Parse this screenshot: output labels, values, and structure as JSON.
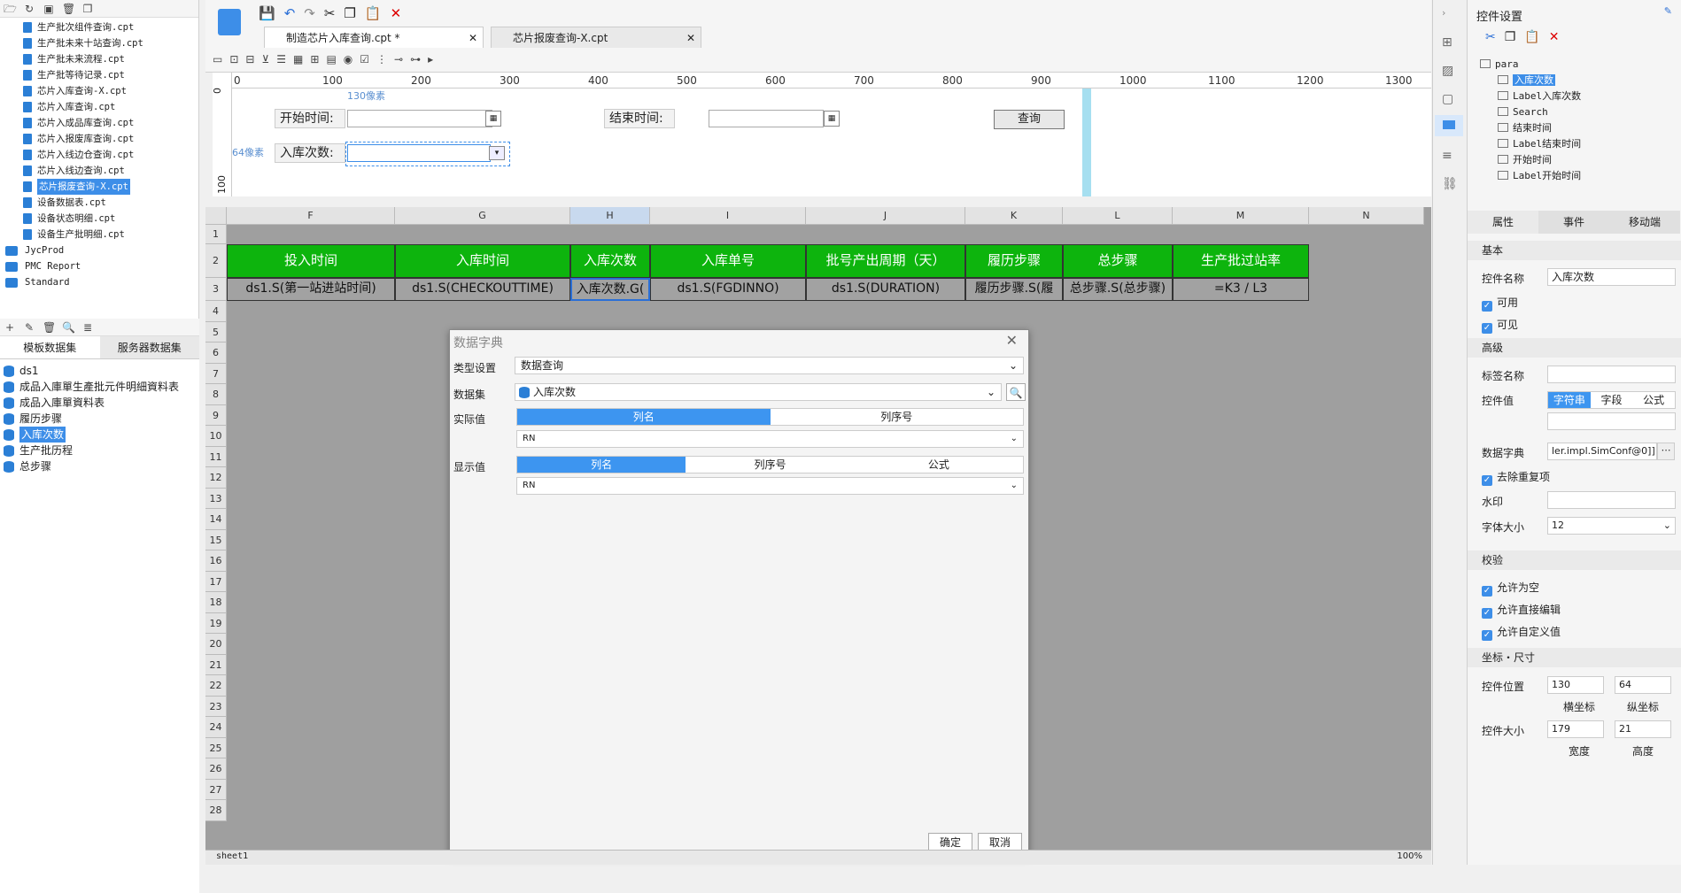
{
  "left": {
    "files": [
      "生产批次组件查询.cpt",
      "生产批未来十站查询.cpt",
      "生产批未来流程.cpt",
      "生产批等待记录.cpt",
      "芯片入库查询-X.cpt",
      "芯片入库查询.cpt",
      "芯片入成品库查询.cpt",
      "芯片入报废库查询.cpt",
      "芯片入线边仓查询.cpt",
      "芯片入线边查询.cpt",
      "芯片报废查询-X.cpt",
      "设备数据表.cpt",
      "设备状态明细.cpt",
      "设备生产批明细.cpt"
    ],
    "selected_file": "芯片报废查询-X.cpt",
    "folders": [
      "JycProd",
      "PMC Report",
      "Standard"
    ],
    "ds_tabs": [
      "模板数据集",
      "服务器数据集"
    ],
    "datasets": [
      "ds1",
      "成品入庫單生產批元件明細資料表",
      "成品入庫單資料表",
      "履历步骤",
      "入库次数",
      "生产批历程",
      "总步骤"
    ],
    "selected_dataset": "入库次数"
  },
  "doc_tabs": [
    "制造芯片入库查询.cpt *",
    "芯片报废查询-X.cpt"
  ],
  "ruler": [
    "0",
    "100",
    "200",
    "300",
    "400",
    "500",
    "600",
    "700",
    "800",
    "900",
    "1000",
    "1100",
    "1200",
    "1300"
  ],
  "vruler": [
    "0",
    "100"
  ],
  "param": {
    "start_label": "开始时间:",
    "end_label": "结束时间:",
    "count_label": "入库次数:",
    "query_btn": "查询",
    "hint_x": "130像素",
    "hint_y": "64像素"
  },
  "sheet": {
    "cols": [
      "F",
      "G",
      "H",
      "I",
      "J",
      "K",
      "L",
      "M",
      "N"
    ],
    "rows": [
      "1",
      "2",
      "3",
      "4",
      "5",
      "6",
      "7",
      "8",
      "9",
      "10",
      "11",
      "12",
      "13",
      "14",
      "15",
      "16",
      "17",
      "18",
      "19",
      "20",
      "21",
      "22",
      "23",
      "24",
      "25",
      "26",
      "27",
      "28"
    ],
    "headers": [
      "投入时间",
      "入库时间",
      "入库次数",
      "入库单号",
      "批号产出周期（天）",
      "履历步骤",
      "总步骤",
      "生产批过站率"
    ],
    "formulas": [
      "ds1.S(第一站进站时间)",
      "ds1.S(CHECKOUTTIME)",
      "入库次数.G(",
      "ds1.S(FGDINNO)",
      "ds1.S(DURATION)",
      "履历步骤.S(履",
      "总步骤.S(总步骤)",
      "=K3 / L3"
    ],
    "sheet_tab": "sheet1",
    "zoom": "100%"
  },
  "dialog": {
    "title": "数据字典",
    "type_label": "类型设置",
    "type_value": "数据查询",
    "dataset_label": "数据集",
    "dataset_value": "入库次数",
    "actual_label": "实际值",
    "actual_tabs": [
      "列名",
      "列序号"
    ],
    "actual_value": "RN",
    "display_label": "显示值",
    "display_tabs": [
      "列名",
      "列序号",
      "公式"
    ],
    "display_value": "RN",
    "ok": "确定",
    "cancel": "取消"
  },
  "right": {
    "title": "控件设置",
    "tree": [
      "para",
      "入库次数",
      "Label入库次数",
      "Search",
      "结束时间",
      "Label结束时间",
      "开始时间",
      "Label开始时间"
    ],
    "tabs": [
      "属性",
      "事件",
      "移动端"
    ],
    "basic": "基本",
    "name_label": "控件名称",
    "name_value": "入库次数",
    "enabled": "可用",
    "visible": "可见",
    "advanced": "高级",
    "tag_label": "标签名称",
    "value_label": "控件值",
    "value_tabs": [
      "字符串",
      "字段",
      "公式"
    ],
    "dict_label": "数据字典",
    "dict_value": "ler.impl.SimConf@0]]",
    "dedupe": "去除重复项",
    "watermark": "水印",
    "fontsize_label": "字体大小",
    "fontsize_value": "12",
    "validate": "校验",
    "allow_empty": "允许为空",
    "allow_edit": "允许直接编辑",
    "allow_custom": "允许自定义值",
    "coord_section": "坐标・尺寸",
    "pos_label": "控件位置",
    "pos_x": "130",
    "pos_y": "64",
    "pos_x_label": "横坐标",
    "pos_y_label": "纵坐标",
    "size_label": "控件大小",
    "width": "179",
    "height": "21",
    "width_label": "宽度",
    "height_label": "高度"
  }
}
